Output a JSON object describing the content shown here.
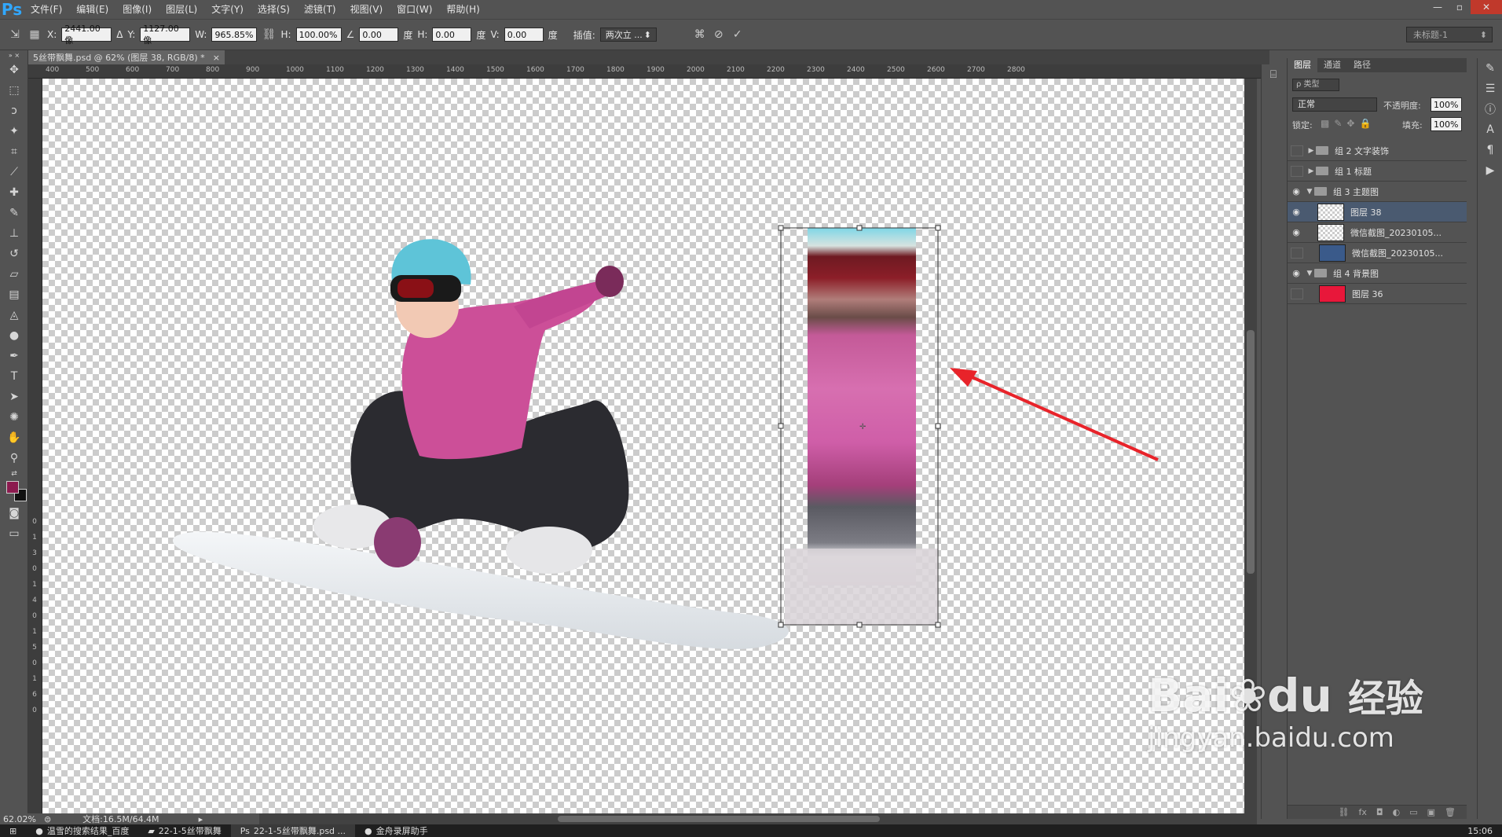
{
  "app": {
    "logo": "Ps"
  },
  "menu": [
    "文件(F)",
    "编辑(E)",
    "图像(I)",
    "图层(L)",
    "文字(Y)",
    "选择(S)",
    "滤镜(T)",
    "视图(V)",
    "窗口(W)",
    "帮助(H)"
  ],
  "window_controls": {
    "minimize": "—",
    "restore": "▫",
    "close": "✕"
  },
  "options": {
    "x_label": "X:",
    "x_value": "2441.00 像",
    "delta_label": "Δ",
    "y_label": "Y:",
    "y_value": "1127.00 像",
    "w_label": "W:",
    "w_value": "965.85%",
    "h_label": "H:",
    "h_value": "100.00%",
    "angle_label": "∠",
    "angle_value": "0.00",
    "angle_unit": "度",
    "hskew_label": "H:",
    "hskew_value": "0.00",
    "hskew_unit": "度",
    "vskew_label": "V:",
    "vskew_value": "0.00",
    "vskew_unit": "度",
    "interp_label": "插值:",
    "interp_value": "两次立 ...",
    "workspace": "未标题-1"
  },
  "doc_tab": {
    "title": "5丝带飘舞.psd @ 62% (图层 38, RGB/8) *",
    "close": "×"
  },
  "ruler_top": [
    "400",
    "500",
    "600",
    "700",
    "800",
    "900",
    "1000",
    "1100",
    "1200",
    "1300",
    "1400",
    "1500",
    "1600",
    "1700",
    "1800",
    "1900",
    "2000",
    "2100",
    "2200",
    "2300",
    "2400",
    "2500",
    "2600",
    "2700",
    "2800"
  ],
  "ruler_left": [
    "0",
    "1",
    "3",
    "0",
    "1",
    "4",
    "0",
    "1",
    "5",
    "0",
    "1",
    "6",
    "0"
  ],
  "status": {
    "zoom": "62.02%",
    "doc": "文档:16.5M/64.4M"
  },
  "layers_panel": {
    "tabs": [
      "图层",
      "通道",
      "路径"
    ],
    "filter_label": "ρ 类型",
    "blend_mode": "正常",
    "opacity_label": "不透明度:",
    "opacity_value": "100%",
    "lock_label": "锁定:",
    "fill_label": "填充:",
    "fill_value": "100%",
    "layers": [
      {
        "name": "组 2 文字装饰"
      },
      {
        "name": "组 1 标题"
      },
      {
        "name": "组 3 主题图"
      },
      {
        "name": "图层 38"
      },
      {
        "name": "微信截图_20230105..."
      },
      {
        "name": "微信截图_20230105..."
      },
      {
        "name": "组 4 背景图"
      },
      {
        "name": "图层 36"
      }
    ]
  },
  "taskbar": [
    {
      "label": "温雪的搜索结果_百度"
    },
    {
      "label": "22-1-5丝带飘舞"
    },
    {
      "label": "22-1-5丝带飘舞.psd ..."
    },
    {
      "label": "金舟录屏助手"
    }
  ],
  "taskbar_time": "15:06",
  "watermark": {
    "brand": "Bai",
    "brand2": "du",
    "cn": "经验",
    "url": "jingyan.baidu.com"
  },
  "colors": {
    "foreground": "#8c1b4f",
    "background": "#111111",
    "accent": "#31a8ff",
    "arrow": "#e8232a"
  }
}
